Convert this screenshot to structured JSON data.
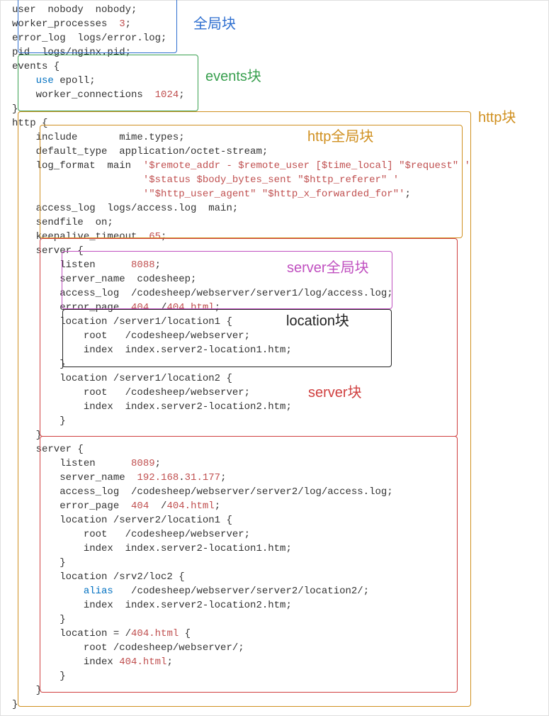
{
  "labels": {
    "global": "全局块",
    "events": "events块",
    "http": "http块",
    "httpglobal": "http全局块",
    "serverglobal": "server全局块",
    "location": "location块",
    "server": "server块"
  },
  "code": {
    "l1a": "user  nobody  nobody;",
    "l2a": "worker_processes  ",
    "l2b": "3",
    "l2c": ";",
    "l3a": "error_log  logs/error.log;",
    "l4a": "pid  logs/nginx.pid;",
    "l5a": "events {",
    "l6a": "    ",
    "l6b": "use",
    "l6c": " epoll;",
    "l7a": "    worker_connections  ",
    "l7b": "1024",
    "l7c": ";",
    "l8a": "}",
    "l9a": "http {",
    "l10a": "    include       mime.types;",
    "l11a": "    default_type  application/octet-stream;",
    "l12a": "    log_format  main  ",
    "l12b": "'$remote_addr - $remote_user [$time_local] \"$request\" '",
    "l13a": "                      ",
    "l13b": "'$status $body_bytes_sent \"$http_referer\" '",
    "l14a": "                      ",
    "l14b": "'\"$http_user_agent\" \"$http_x_forwarded_for\"'",
    "l14c": ";",
    "l15a": "    access_log  logs/access.log  main;",
    "l16a": "    sendfile  on;",
    "l17a": "    keepalive_timeout  ",
    "l17b": "65",
    "l17c": ";",
    "l18a": "    server {",
    "l19a": "        listen      ",
    "l19b": "8088",
    "l19c": ";",
    "l20a": "        server_name  codesheep;",
    "l21a": "        access_log  /codesheep/webserver/server1/log/access.log;",
    "l22a": "        error_page  ",
    "l22b": "404",
    "l22c": "  /",
    "l22d": "404.html",
    "l22e": ";",
    "l23a": "        location /server1/location1 {",
    "l24a": "            root   /codesheep/webserver;",
    "l25a": "            index  index.server2-location1.htm;",
    "l26a": "        }",
    "l27a": "        location /server1/location2 {",
    "l28a": "            root   /codesheep/webserver;",
    "l29a": "            index  index.server2-location2.htm;",
    "l30a": "        }",
    "l31a": "    }",
    "l32a": "    server {",
    "l33a": "        listen      ",
    "l33b": "8089",
    "l33c": ";",
    "l34a": "        server_name  ",
    "l34b": "192.168",
    "l34c": ".",
    "l34d": "31.177",
    "l34e": ";",
    "l35a": "        access_log  /codesheep/webserver/server2/log/access.log;",
    "l36a": "        error_page  ",
    "l36b": "404",
    "l36c": "  /",
    "l36d": "404.html",
    "l36e": ";",
    "l37a": "        location /server2/location1 {",
    "l38a": "            root   /codesheep/webserver;",
    "l39a": "            index  index.server2-location1.htm;",
    "l40a": "        }",
    "l41a": "        location /srv2/loc2 {",
    "l42a": "            ",
    "l42b": "alias",
    "l42c": "   /codesheep/webserver/server2/location2/;",
    "l43a": "            index  index.server2-location2.htm;",
    "l44a": "        }",
    "l45a": "        location = /",
    "l45b": "404.html",
    "l45c": " {",
    "l46a": "            root /codesheep/webserver/;",
    "l47a": "            index ",
    "l47b": "404.html",
    "l47c": ";",
    "l48a": "        }",
    "l49a": "    }",
    "l50a": "}"
  }
}
